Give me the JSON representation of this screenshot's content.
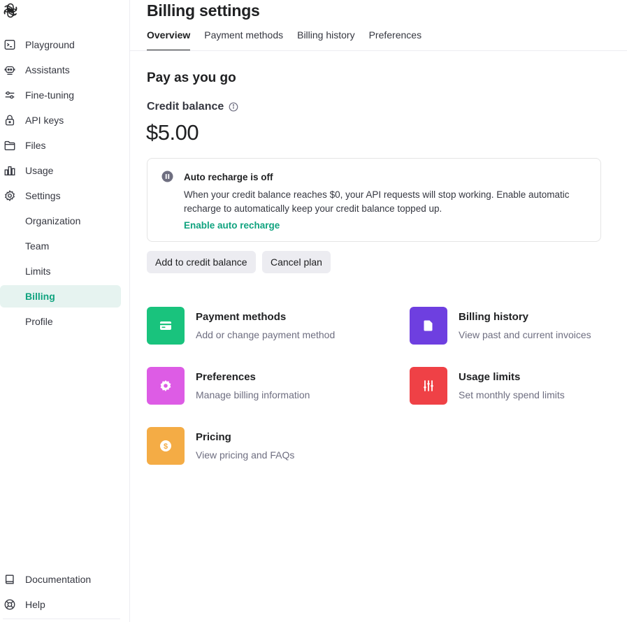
{
  "sidebar": {
    "items": [
      {
        "label": "Playground"
      },
      {
        "label": "Assistants"
      },
      {
        "label": "Fine-tuning"
      },
      {
        "label": "API keys"
      },
      {
        "label": "Files"
      },
      {
        "label": "Usage"
      },
      {
        "label": "Settings"
      }
    ],
    "sub_items": [
      {
        "label": "Organization"
      },
      {
        "label": "Team"
      },
      {
        "label": "Limits"
      },
      {
        "label": "Billing",
        "active": true
      },
      {
        "label": "Profile"
      }
    ],
    "bottom_items": [
      {
        "label": "Documentation"
      },
      {
        "label": "Help"
      }
    ]
  },
  "header": {
    "title": "Billing settings",
    "tabs": [
      {
        "label": "Overview",
        "active": true
      },
      {
        "label": "Payment methods"
      },
      {
        "label": "Billing history"
      },
      {
        "label": "Preferences"
      }
    ]
  },
  "main": {
    "plan_title": "Pay as you go",
    "credit_label": "Credit balance",
    "credit_amount": "$5.00",
    "recharge": {
      "title": "Auto recharge is off",
      "description": "When your credit balance reaches $0, your API requests will stop working. Enable automatic recharge to automatically keep your credit balance topped up.",
      "link": "Enable auto recharge"
    },
    "buttons": {
      "add_credit": "Add to credit balance",
      "cancel_plan": "Cancel plan"
    },
    "tiles": [
      {
        "title": "Payment methods",
        "description": "Add or change payment method",
        "icon": "credit-card-icon",
        "color": "#19c37d"
      },
      {
        "title": "Billing history",
        "description": "View past and current invoices",
        "icon": "document-icon",
        "color": "#6e3fe0"
      },
      {
        "title": "Preferences",
        "description": "Manage billing information",
        "icon": "gear-icon",
        "color": "#dd5ce5"
      },
      {
        "title": "Usage limits",
        "description": "Set monthly spend limits",
        "icon": "sliders-icon",
        "color": "#ef4146"
      },
      {
        "title": "Pricing",
        "description": "View pricing and FAQs",
        "icon": "dollar-coin-icon",
        "color": "#f4ac45"
      }
    ]
  },
  "colors": {
    "accent": "#10a37f",
    "active_bg": "#e6f3f0",
    "button_bg": "#ececf1"
  }
}
